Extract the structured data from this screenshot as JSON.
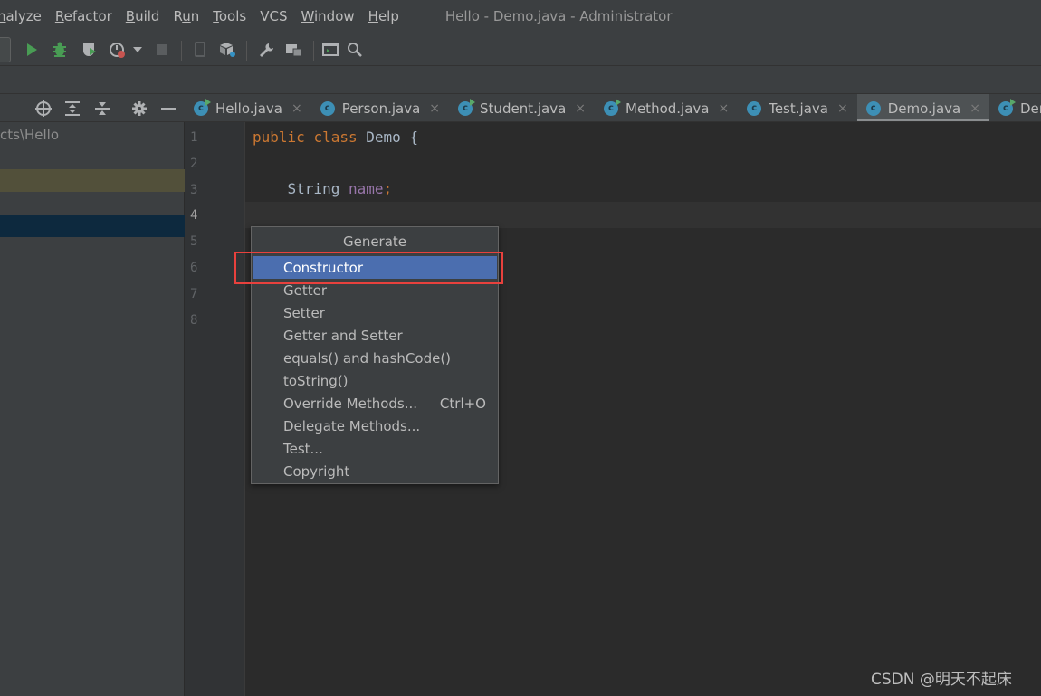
{
  "menu": {
    "items": [
      {
        "label": "nalyze",
        "mnemonic_index": 0
      },
      {
        "label": "Refactor",
        "mnemonic_index": 0
      },
      {
        "label": "Build",
        "mnemonic_index": 0
      },
      {
        "label": "Run",
        "mnemonic_index": 1
      },
      {
        "label": "Tools",
        "mnemonic_index": 0
      },
      {
        "label": "VCS",
        "mnemonic_index": -1
      },
      {
        "label": "Window",
        "mnemonic_index": 0
      },
      {
        "label": "Help",
        "mnemonic_index": 0
      }
    ],
    "window_title": "Hello - Demo.java - Administrator"
  },
  "toolbar": {
    "icons": [
      "run-icon",
      "debug-icon",
      "coverage-icon",
      "profile-icon",
      "run-dropdown-icon",
      "stop-icon",
      "device-icon",
      "build-artifact-icon",
      "settings-wrench-icon",
      "project-structure-icon",
      "terminal-icon",
      "search-icon"
    ]
  },
  "project": {
    "path": "cts\\Hello",
    "header_icons": [
      "locate-icon",
      "expand-all-icon",
      "collapse-all-icon",
      "gear-icon",
      "hide-icon"
    ]
  },
  "tabs": [
    {
      "label": "Hello.java",
      "active": false,
      "runnable": true
    },
    {
      "label": "Person.java",
      "active": false,
      "runnable": false
    },
    {
      "label": "Student.java",
      "active": false,
      "runnable": true
    },
    {
      "label": "Method.java",
      "active": false,
      "runnable": true
    },
    {
      "label": "Test.java",
      "active": false,
      "runnable": false
    },
    {
      "label": "Demo.java",
      "active": true,
      "runnable": false
    },
    {
      "label": "DemoAp",
      "active": false,
      "runnable": true
    }
  ],
  "editor": {
    "line_numbers": [
      "1",
      "2",
      "3",
      "4",
      "5",
      "6",
      "7",
      "8"
    ],
    "current_line": "4",
    "code": {
      "line1": {
        "kw1": "public",
        "kw2": "class",
        "name": "Demo",
        "brace": "{"
      },
      "line3": {
        "type": "String",
        "field": "name",
        "semi": ";"
      }
    }
  },
  "popup": {
    "title": "Generate",
    "items": [
      {
        "label": "Constructor",
        "shortcut": "",
        "selected": true
      },
      {
        "label": "Getter",
        "shortcut": "",
        "selected": false
      },
      {
        "label": "Setter",
        "shortcut": "",
        "selected": false
      },
      {
        "label": "Getter and Setter",
        "shortcut": "",
        "selected": false
      },
      {
        "label": "equals() and hashCode()",
        "shortcut": "",
        "selected": false
      },
      {
        "label": "toString()",
        "shortcut": "",
        "selected": false
      },
      {
        "label": "Override Methods...",
        "shortcut": "Ctrl+O",
        "selected": false
      },
      {
        "label": "Delegate Methods...",
        "shortcut": "",
        "selected": false
      },
      {
        "label": "Test...",
        "shortcut": "",
        "selected": false
      },
      {
        "label": "Copyright",
        "shortcut": "",
        "selected": false
      }
    ]
  },
  "watermark": "CSDN @明天不起床",
  "colors": {
    "accent_selection": "#4b6eaf",
    "highlight_annotation": "#e8413d",
    "keyword": "#cc7832",
    "field": "#9876aa"
  }
}
